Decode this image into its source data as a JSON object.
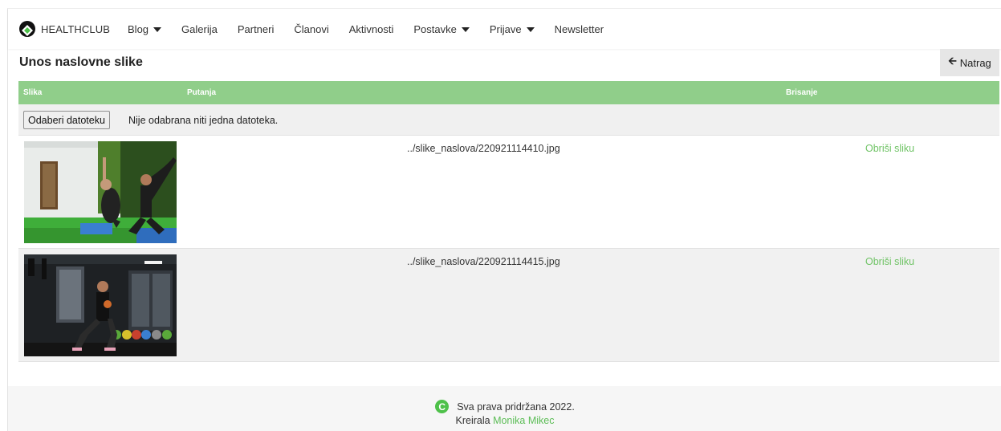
{
  "navbar": {
    "brand": "HEALTHCLUB",
    "items": [
      {
        "label": "Blog",
        "dropdown": true
      },
      {
        "label": "Galerija",
        "dropdown": false
      },
      {
        "label": "Partneri",
        "dropdown": false
      },
      {
        "label": "Članovi",
        "dropdown": false
      },
      {
        "label": "Aktivnosti",
        "dropdown": false
      },
      {
        "label": "Postavke",
        "dropdown": true
      },
      {
        "label": "Prijave",
        "dropdown": true
      },
      {
        "label": "Newsletter",
        "dropdown": false
      }
    ]
  },
  "page": {
    "title": "Unos naslovne slike",
    "back_label": "Natrag",
    "back_icon": "arrow-left-icon"
  },
  "table": {
    "headers": {
      "image": "Slika",
      "path": "Putanja",
      "delete": "Brisanje"
    },
    "upload": {
      "button_label": "Odaberi datoteku",
      "status": "Nije odabrana niti jedna datoteka."
    },
    "rows": [
      {
        "path": "../slike_naslova/220921114410.jpg",
        "delete_label": "Obriši sliku"
      },
      {
        "path": "../slike_naslova/220921114415.jpg",
        "delete_label": "Obriši sliku"
      }
    ]
  },
  "footer": {
    "copyright_symbol": "C",
    "copyright": "Sva prava pridržana 2022.",
    "author_prefix": "Kreirala",
    "author_name": "Monika Mikec"
  },
  "colors": {
    "accent_green": "#90ce8a",
    "link_green": "#6fc365",
    "footer_icon_green": "#4ec14a"
  }
}
